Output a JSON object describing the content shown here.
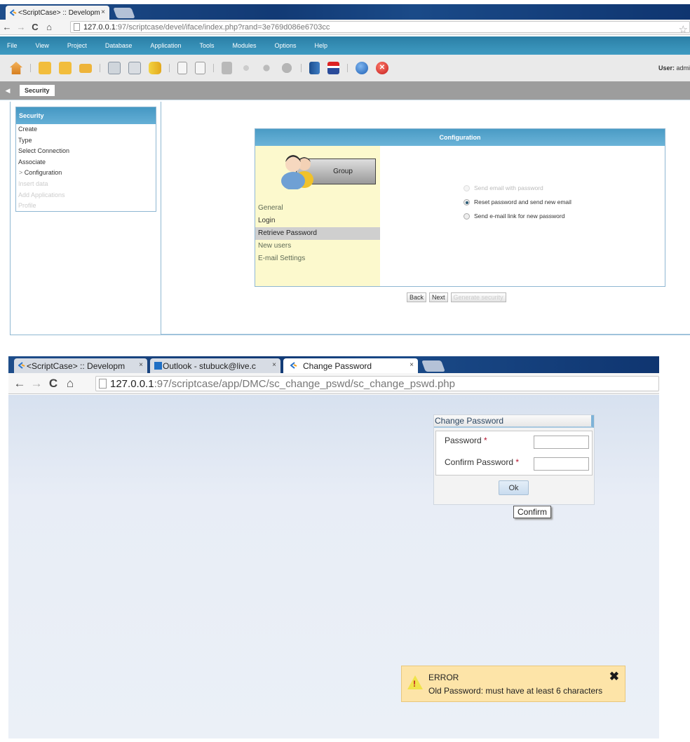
{
  "window1": {
    "tabs": [
      {
        "label": "<ScriptCase> :: Developm",
        "close": "×"
      }
    ],
    "address": {
      "host": "127.0.0.1",
      "rest": ":97/scriptcase/devel/iface/index.php?rand=3e769d086e6703cc"
    },
    "menu": [
      "File",
      "View",
      "Project",
      "Database",
      "Application",
      "Tools",
      "Modules",
      "Options",
      "Help"
    ],
    "toolbar_icons": [
      "home-icon",
      "new-project-icon",
      "open-project-icon",
      "folder-icon",
      "new-connection-icon",
      "edit-connection-icon",
      "database-icon",
      "new-app-icon",
      "copy-app-icon",
      "save-icon",
      "generate-icon",
      "generate-all-icon",
      "run-icon",
      "docs-icon",
      "language-icon",
      "help-icon",
      "exit-icon"
    ],
    "user_label": "User:",
    "user_value": "admi",
    "breadcrumb": "Security",
    "left_tree": {
      "title": "Security",
      "items": [
        {
          "label": "Create",
          "state": "done"
        },
        {
          "label": "Type",
          "state": "done"
        },
        {
          "label": "Select Connection",
          "state": "done"
        },
        {
          "label": "Associate",
          "state": "done"
        },
        {
          "label": "Configuration",
          "state": "current"
        },
        {
          "label": "Insert data",
          "state": "disabled"
        },
        {
          "label": "Add Applications",
          "state": "disabled"
        },
        {
          "label": "Profile",
          "state": "disabled"
        }
      ],
      "current_marker": ">"
    },
    "config": {
      "title": "Configuration",
      "group_button": "Group",
      "menu": [
        {
          "label": "General",
          "state": "normal"
        },
        {
          "label": "Login",
          "state": "plain"
        },
        {
          "label": "Retrieve Password",
          "state": "selected"
        },
        {
          "label": "New users",
          "state": "normal"
        },
        {
          "label": "E-mail Settings",
          "state": "normal"
        }
      ],
      "options": [
        {
          "label": "Send email with password",
          "checked": false,
          "disabled": true
        },
        {
          "label": "Reset password and send new email",
          "checked": true,
          "disabled": false
        },
        {
          "label": "Send e-mail link for new password",
          "checked": false,
          "disabled": false
        }
      ]
    },
    "buttons": {
      "back": "Back",
      "next": "Next",
      "generate": "Generate security"
    }
  },
  "window2": {
    "tabs": [
      {
        "label": "<ScriptCase> :: Developm",
        "close": "×"
      },
      {
        "label": "Outlook - stubuck@live.c",
        "close": "×"
      },
      {
        "label": "Change Password",
        "close": "×"
      }
    ],
    "address": {
      "host": "127.0.0.1",
      "rest": ":97/scriptcase/app/DMC/sc_change_pswd/sc_change_pswd.php"
    },
    "form": {
      "title": "Change Password",
      "password_label": "Password",
      "confirm_label": "Confirm Password",
      "required_mark": "*",
      "password_value": "",
      "confirm_value": "",
      "ok": "Ok",
      "tooltip": "Confirm"
    },
    "error": {
      "title": "ERROR",
      "message": "Old Password:  must have at least 6 characters",
      "close": "✖",
      "icon": "!"
    }
  },
  "colors": {
    "menubar": "#2b7fa6",
    "header_blue": "#4a9bc5",
    "config_left_bg": "#fcf9cd",
    "error_bg": "#fde4a8",
    "required": "#b5122e"
  }
}
